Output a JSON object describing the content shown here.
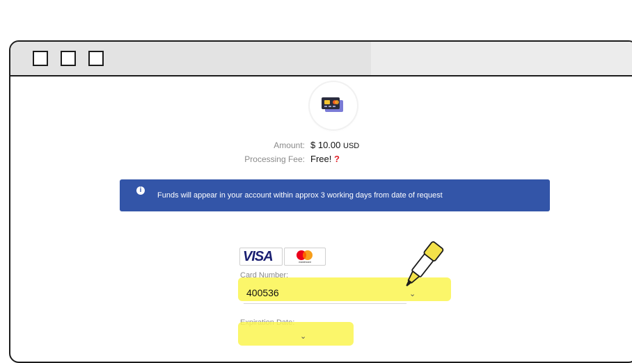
{
  "payment": {
    "amount_label": "Amount:",
    "amount_value": "$ 10.00",
    "amount_currency": "USD",
    "fee_label": "Processing Fee:",
    "fee_value": "Free!",
    "fee_help": "?"
  },
  "notice": {
    "text": "Funds will appear in your account within approx 3 working days from date of request"
  },
  "card_brands": [
    "VISA",
    "mastercard"
  ],
  "form": {
    "card_number_label": "Card Number:",
    "card_number_value": "400536",
    "expiration_label": "Expiration Date:"
  },
  "colors": {
    "banner": "#3355a8",
    "highlight": "#faf550",
    "fee_help": "#e0242b"
  },
  "icons": [
    "credit-card-icon",
    "info-icon",
    "chevron-down-icon",
    "highlighter-pen-icon"
  ]
}
